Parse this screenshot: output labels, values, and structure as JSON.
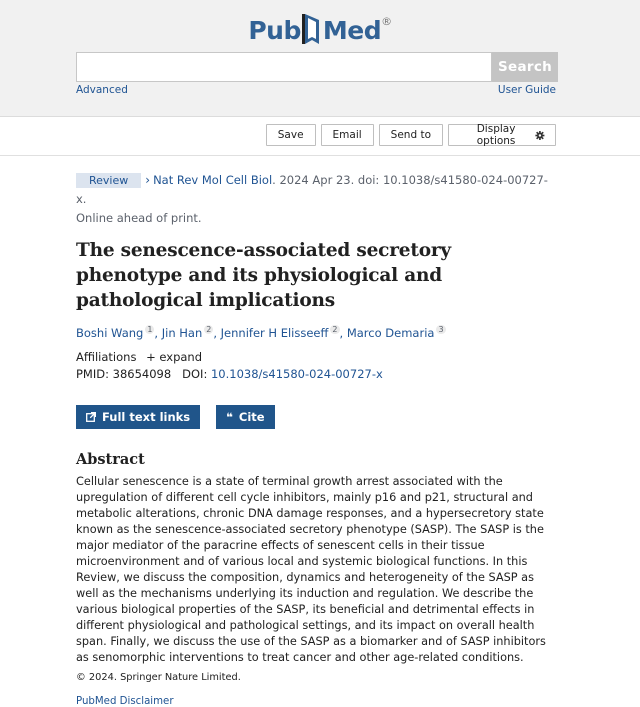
{
  "header": {
    "logo": {
      "part1": "Pub",
      "part2": "Med",
      "reg": "®"
    },
    "search": {
      "value": "",
      "placeholder": "",
      "button_label": "Search"
    },
    "advanced_link": "Advanced",
    "user_guide_link": "User Guide"
  },
  "actions": {
    "save": "Save",
    "email": "Email",
    "send_to": "Send to",
    "display_options": "Display options"
  },
  "article": {
    "type_badge": "Review",
    "journal": "Nat Rev Mol Cell Biol",
    "citation": ". 2024 Apr 23. doi: 10.1038/s41580-024-00727-x.",
    "status": "Online ahead of print.",
    "title": "The senescence-associated secretory phenotype and its physiological and pathological implications",
    "authors": [
      {
        "name": "Boshi Wang",
        "aff": "1"
      },
      {
        "name": "Jin Han",
        "aff": "2"
      },
      {
        "name": "Jennifer H Elisseeff",
        "aff": "2"
      },
      {
        "name": "Marco Demaria",
        "aff": "3"
      }
    ],
    "affiliations_label": "Affiliations",
    "expand_label": "expand",
    "pmid_label": "PMID: 38654098",
    "doi_label": "DOI:",
    "doi": "10.1038/s41580-024-00727-x",
    "full_text_button": "Full text links",
    "cite_button": "Cite",
    "abstract_heading": "Abstract",
    "abstract": "Cellular senescence is a state of terminal growth arrest associated with the upregulation of different cell cycle inhibitors, mainly p16 and p21, structural and metabolic alterations, chronic DNA damage responses, and a hypersecretory state known as the senescence-associated secretory phenotype (SASP). The SASP is the major mediator of the paracrine effects of senescent cells in their tissue microenvironment and of various local and systemic biological functions. In this Review, we discuss the composition, dynamics and heterogeneity of the SASP as well as the mechanisms underlying its induction and regulation. We describe the various biological properties of the SASP, its beneficial and detrimental effects in different physiological and pathological settings, and its impact on overall health span. Finally, we discuss the use of the SASP as a biomarker and of SASP inhibitors as senomorphic interventions to treat cancer and other age-related conditions.",
    "copyright": "© 2024. Springer Nature Limited.",
    "disclaimer": "PubMed Disclaimer"
  },
  "colors": {
    "brand": "#326295",
    "link": "#205493",
    "button": "#20558a"
  },
  "icons": [
    "pubmed-flag-icon",
    "chevron-right-icon",
    "plus-icon",
    "gear-icon",
    "external-link-icon",
    "quote-icon"
  ]
}
